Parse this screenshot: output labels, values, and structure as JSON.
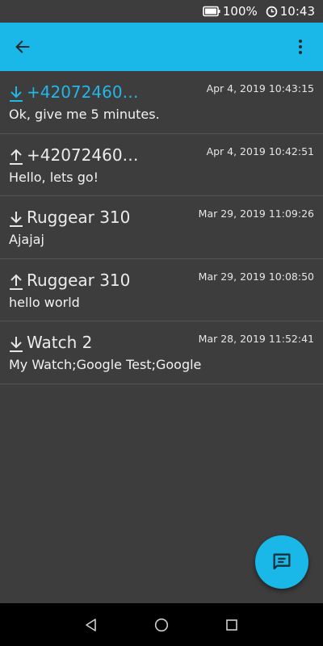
{
  "status_bar": {
    "battery": "100%",
    "time": "10:43",
    "icons": [
      "battery-icon",
      "clock-icon"
    ]
  },
  "app_bar": {
    "icons": [
      "back-arrow-icon",
      "overflow-menu-icon"
    ],
    "color": "#1ab8e8"
  },
  "messages": [
    {
      "direction": "incoming",
      "icon": "download-icon",
      "contact": "+42072460…",
      "time": "Apr 4, 2019 10:43:15",
      "text": "Ok, give me 5 minutes.",
      "highlighted": true
    },
    {
      "direction": "outgoing",
      "icon": "upload-icon",
      "contact": "+42072460…",
      "time": "Apr 4, 2019 10:42:51",
      "text": "Hello, lets go!",
      "highlighted": false
    },
    {
      "direction": "incoming",
      "icon": "download-icon",
      "contact": "Ruggear 310",
      "time": "Mar 29, 2019 11:09:26",
      "text": "Ajajaj",
      "highlighted": false
    },
    {
      "direction": "outgoing",
      "icon": "upload-icon",
      "contact": "Ruggear 310",
      "time": "Mar 29, 2019 10:08:50",
      "text": "hello world",
      "highlighted": false
    },
    {
      "direction": "incoming",
      "icon": "download-icon",
      "contact": "Watch 2",
      "time": "Mar 28, 2019 11:52:41",
      "text": "My Watch;Google Test;Google",
      "highlighted": false
    }
  ],
  "fab": {
    "icon": "new-message-icon"
  },
  "nav_bar": {
    "icons": [
      "nav-back-icon",
      "nav-home-icon",
      "nav-recents-icon"
    ]
  },
  "colors": {
    "accent": "#1ab8e8",
    "highlight_text": "#22b7e6",
    "background": "#3d3d3d"
  }
}
